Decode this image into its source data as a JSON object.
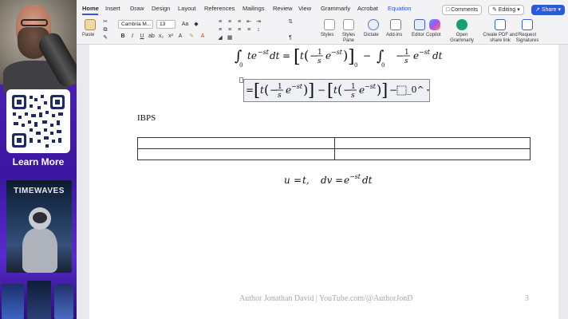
{
  "overlay": {
    "qr_caption": "Learn More",
    "book_title": "TIMEWAVES"
  },
  "ribbon": {
    "tabs": [
      "Home",
      "Insert",
      "Draw",
      "Design",
      "Layout",
      "References",
      "Mailings",
      "Review",
      "View",
      "Grammarly",
      "Acrobat",
      "Equation"
    ],
    "active_tab": "Home",
    "comments_label": "Comments",
    "editing_label": "Editing",
    "share_label": "Share",
    "paste_label": "Paste",
    "font_name": "Cambria M...",
    "font_size": "13",
    "styles_label": "Styles",
    "styles_pane_label": "Styles Pane",
    "dictate_label": "Dictate",
    "addins_label": "Add-ins",
    "editor_label": "Editor",
    "copilot_label": "Copilot",
    "grammarly_label": "Open Grammarly",
    "pdf_label": "Create PDF and share link",
    "signatures_label": "Request Signatures"
  },
  "document": {
    "section_label": "IBPS",
    "eq2_placeholder": "_0^",
    "footer": "Author Jonathan David | YouTube.com/@AuthorJonD",
    "page_number": "3"
  },
  "colors": {
    "accent": "#2d5bd5",
    "panel_purple": "#4a1fb0"
  }
}
